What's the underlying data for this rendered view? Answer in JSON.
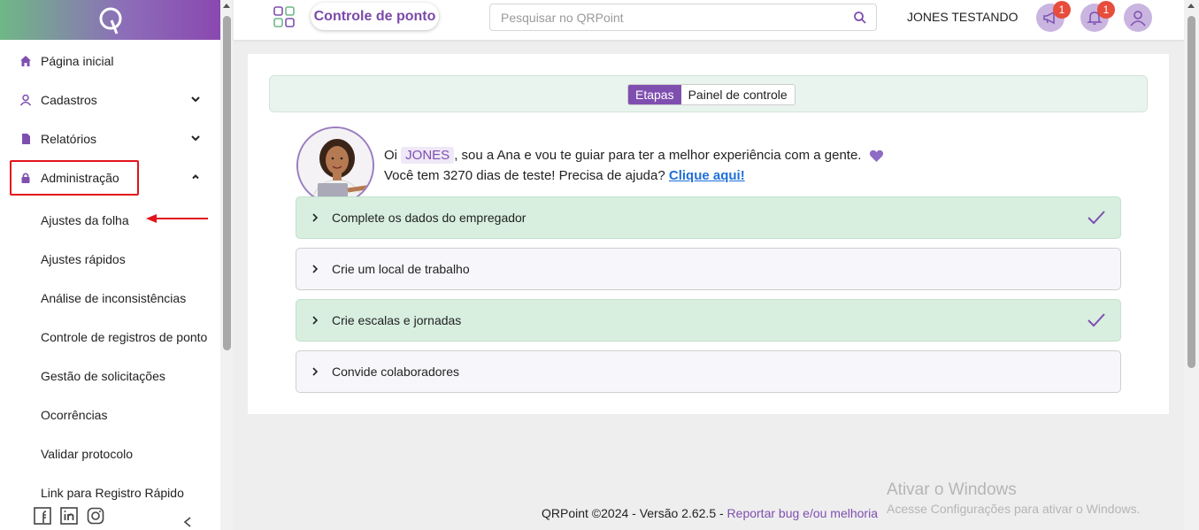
{
  "sidebar": {
    "items": [
      {
        "label": "Página inicial",
        "icon": "home-icon"
      },
      {
        "label": "Cadastros",
        "icon": "user-icon"
      },
      {
        "label": "Relatórios",
        "icon": "file-icon"
      },
      {
        "label": "Administração",
        "icon": "lock-icon"
      }
    ],
    "submenu": [
      "Ajustes da folha",
      "Ajustes rápidos",
      "Análise de inconsistências",
      "Controle de registros de ponto",
      "Gestão de solicitações",
      "Ocorrências",
      "Validar protocolo",
      "Link para Registro Rápido"
    ],
    "footer_icons": [
      "facebook-icon",
      "linkedin-icon",
      "instagram-icon"
    ]
  },
  "topbar": {
    "title": "Controle de ponto",
    "search_placeholder": "Pesquisar no QRPoint",
    "username": "JONES TESTANDO",
    "announce_badge": "1",
    "notif_badge": "1"
  },
  "tabs": {
    "etapas": "Etapas",
    "painel": "Painel de controle"
  },
  "greeting": {
    "oi": "Oi",
    "name": "JONES",
    "line1_rest": ", sou a Ana e vou te guiar para ter a melhor experiência com a gente.",
    "line2": "Você tem 3270 dias de teste! Precisa de ajuda?",
    "help_link": "Clique aqui!"
  },
  "steps": [
    {
      "label": "Complete os dados do empregador",
      "done": true
    },
    {
      "label": "Crie um local de trabalho",
      "done": false
    },
    {
      "label": "Crie escalas e jornadas",
      "done": true
    },
    {
      "label": "Convide colaboradores",
      "done": false
    }
  ],
  "footer": {
    "text": "QRPoint ©2024 - Versão 2.62.5 -",
    "link": "Reportar bug e/ou melhoria"
  },
  "watermark": {
    "title": "Ativar o Windows",
    "subtitle": "Acesse Configurações para ativar o Windows."
  },
  "colors": {
    "accent": "#7f4fb0",
    "done_bg": "#d8efe0",
    "highlight_red": "#e3131b"
  }
}
